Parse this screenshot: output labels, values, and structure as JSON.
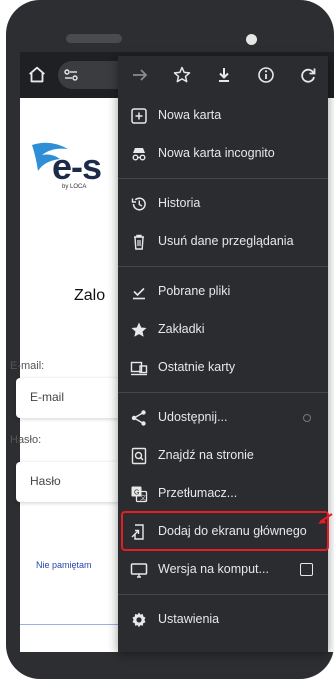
{
  "browser": {
    "url_text": ""
  },
  "page": {
    "logo_text": "e-s",
    "logo_sub": "by LOCA",
    "heading": "Zalo",
    "email_label": "E-mail:",
    "email_placeholder": "E-mail",
    "password_label": "Hasło:",
    "password_placeholder": "Hasło",
    "forgot_link": "Nie pamiętam"
  },
  "menu": {
    "items": [
      {
        "label": "Nowa karta",
        "icon": "new-tab-icon"
      },
      {
        "label": "Nowa karta incognito",
        "icon": "incognito-icon"
      },
      {
        "label": "Historia",
        "icon": "history-icon"
      },
      {
        "label": "Usuń dane przeglądania",
        "icon": "trash-icon"
      },
      {
        "label": "Pobrane pliki",
        "icon": "downloads-icon"
      },
      {
        "label": "Zakładki",
        "icon": "star-icon"
      },
      {
        "label": "Ostatnie karty",
        "icon": "recent-tabs-icon"
      },
      {
        "label": "Udostępnij...",
        "icon": "share-icon"
      },
      {
        "label": "Znajdź na stronie",
        "icon": "find-icon"
      },
      {
        "label": "Przetłumacz...",
        "icon": "translate-icon"
      },
      {
        "label": "Dodaj do ekranu głównego",
        "icon": "add-to-home-icon"
      },
      {
        "label": "Wersja na komput...",
        "icon": "desktop-icon"
      },
      {
        "label": "Ustawienia",
        "icon": "gear-icon"
      }
    ]
  },
  "colors": {
    "menu_bg": "#2b2c2f",
    "highlight": "#e31e24",
    "link": "#2a46a8"
  }
}
